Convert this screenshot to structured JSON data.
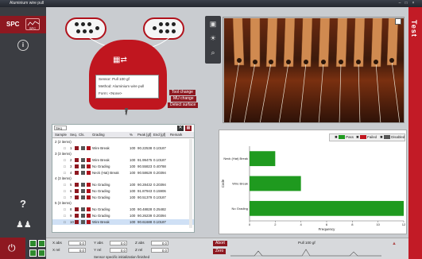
{
  "window": {
    "title": "Aluminium wire pull"
  },
  "sidebar": {
    "logo_label": "SPC",
    "logo_sub": "SPC"
  },
  "brand_strip": {
    "label": "Test"
  },
  "test_box": {
    "sensor": "Sensor: Pull 100 gf",
    "method": "Method: Aluminium wire pull",
    "form": "Form: <None>"
  },
  "machine_buttons": [
    "Tool change",
    "MU change",
    "Detect surface"
  ],
  "machine_digit": "1",
  "table": {
    "search_value": "Seq",
    "columns": [
      "Sample",
      "Seq.",
      "Cls.",
      "Grading",
      "%",
      "Peak [gf]",
      "End [gf]",
      "Remark"
    ],
    "rows": [
      {
        "type": "group",
        "sample": "2 (2 items)"
      },
      {
        "type": "item",
        "seq": "1",
        "grading": "Wire Break",
        "pct": "100",
        "peak": "90.22538",
        "end": "0.10187"
      },
      {
        "type": "group",
        "sample": "3 (3 items)"
      },
      {
        "type": "item",
        "seq": "2",
        "grading": "Wire Break",
        "pct": "100",
        "peak": "91.99475",
        "end": "0.10187"
      },
      {
        "type": "item",
        "seq": "3",
        "grading": "No Grading",
        "pct": "100",
        "peak": "90.55823",
        "end": "0.40788"
      },
      {
        "type": "item",
        "seq": "4",
        "grading": "Neck (Hat) Break",
        "pct": "100",
        "peak": "90.58629",
        "end": "0.20394"
      },
      {
        "type": "group",
        "sample": "4 (3 items)"
      },
      {
        "type": "item",
        "seq": "5",
        "grading": "No Grading",
        "pct": "100",
        "peak": "90.28432",
        "end": "0.20394"
      },
      {
        "type": "item",
        "seq": "6",
        "grading": "No Grading",
        "pct": "100",
        "peak": "91.87943",
        "end": "0.15906"
      },
      {
        "type": "item",
        "seq": "7",
        "grading": "No Grading",
        "pct": "100",
        "peak": "90.51379",
        "end": "0.10187"
      },
      {
        "type": "group",
        "sample": "5 (3 items)"
      },
      {
        "type": "item",
        "seq": "8",
        "grading": "No Grading",
        "pct": "100",
        "peak": "90.48828",
        "end": "0.25482"
      },
      {
        "type": "item",
        "seq": "9",
        "grading": "No Grading",
        "pct": "100",
        "peak": "90.26239",
        "end": "0.20394"
      },
      {
        "type": "item",
        "seq": "10",
        "grading": "Wire Break",
        "pct": "100",
        "peak": "90.61688",
        "end": "0.10187",
        "selected": true
      }
    ]
  },
  "legend": [
    {
      "label": "Pass",
      "color": "#1f9a1f"
    },
    {
      "label": "Failed",
      "color": "#c0161f"
    },
    {
      "label": "Disabled",
      "color": "#555555"
    }
  ],
  "chart_data": {
    "type": "bar",
    "orientation": "horizontal",
    "categories": [
      "Neck (Hat) Break",
      "Wire Break",
      "No Grading"
    ],
    "values": [
      2,
      4,
      12
    ],
    "xlabel": "Frequency",
    "ylabel": "Code",
    "xticks": [
      "0",
      "2",
      "4",
      "6",
      "8",
      "10",
      "12"
    ],
    "xlim": [
      0,
      12
    ],
    "bar_color": "#1f9a1f"
  },
  "bottom": {
    "x_abs_label": "X abs",
    "x_abs": "0.0",
    "y_abs_label": "Y abs",
    "y_abs": "0.0",
    "z_abs_label": "Z abs",
    "z_abs": "0.0",
    "x_rel_label": "X rel",
    "x_rel": "0.0",
    "y_rel_label": "Y rel",
    "y_rel": "0.0",
    "z_rel_label": "Z rel",
    "z_rel": "0.0",
    "status": "Sensor specific initialization finished",
    "abort": "Abort",
    "zero": "Zero",
    "graph_title": "Pull 100 gf"
  }
}
